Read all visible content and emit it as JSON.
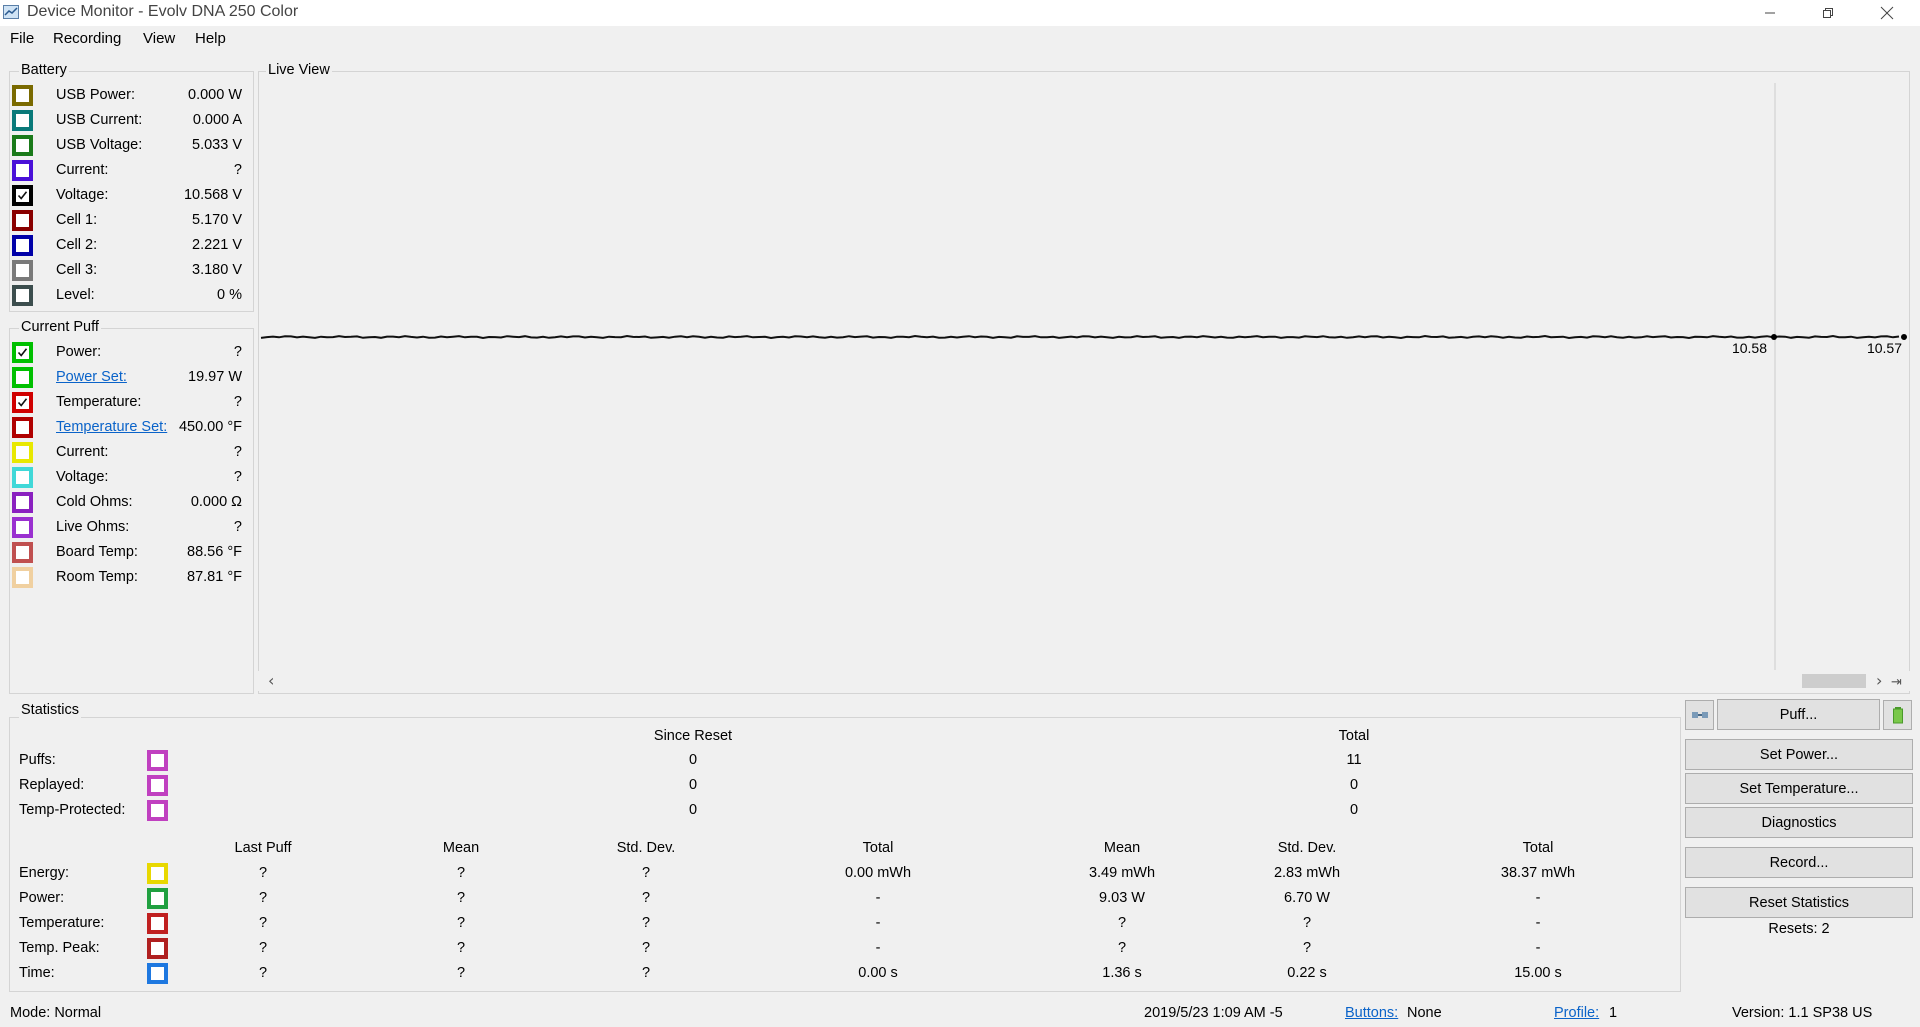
{
  "window": {
    "title": "Device Monitor - Evolv DNA 250 Color"
  },
  "menu": [
    "File",
    "Recording",
    "View",
    "Help"
  ],
  "battery": {
    "title": "Battery",
    "items": [
      {
        "label": "USB Power:",
        "value": "0.000 W",
        "color": "#7a6a00",
        "checked": false
      },
      {
        "label": "USB Current:",
        "value": "0.000 A",
        "color": "#0a7a7a",
        "checked": false
      },
      {
        "label": "USB Voltage:",
        "value": "5.033 V",
        "color": "#1a7a1a",
        "checked": false
      },
      {
        "label": "Current:",
        "value": "?",
        "color": "#4a10d8",
        "checked": false
      },
      {
        "label": "Voltage:",
        "value": "10.568 V",
        "color": "#000000",
        "checked": true
      },
      {
        "label": "Cell 1:",
        "value": "5.170 V",
        "color": "#8a0000",
        "checked": false
      },
      {
        "label": "Cell 2:",
        "value": "2.221 V",
        "color": "#0000a8",
        "checked": false
      },
      {
        "label": "Cell 3:",
        "value": "3.180 V",
        "color": "#7a7a7a",
        "checked": false
      },
      {
        "label": "Level:",
        "value": "0 %",
        "color": "#3c4e4e",
        "checked": false
      }
    ]
  },
  "current_puff": {
    "title": "Current Puff",
    "items": [
      {
        "label": "Power:",
        "value": "?",
        "color": "#00c000",
        "checked": true,
        "link": false
      },
      {
        "label": "Power Set:",
        "value": "19.97 W",
        "color": "#00c000",
        "checked": false,
        "link": true
      },
      {
        "label": "Temperature:",
        "value": "?",
        "color": "#d00000",
        "checked": true,
        "link": false
      },
      {
        "label": "Temperature Set:",
        "value": "450.00 °F",
        "color": "#b00000",
        "checked": false,
        "link": true
      },
      {
        "label": "Current:",
        "value": "?",
        "color": "#e8e800",
        "checked": false,
        "link": false
      },
      {
        "label": "Voltage:",
        "value": "?",
        "color": "#40d8d8",
        "checked": false,
        "link": false
      },
      {
        "label": "Cold Ohms:",
        "value": "0.000 Ω",
        "color": "#8a20c0",
        "checked": false,
        "link": false
      },
      {
        "label": "Live Ohms:",
        "value": "?",
        "color": "#9a30d0",
        "checked": false,
        "link": false
      },
      {
        "label": "Board Temp:",
        "value": "88.56 °F",
        "color": "#c05050",
        "checked": false,
        "link": false
      },
      {
        "label": "Room Temp:",
        "value": "87.81 °F",
        "color": "#f0d0a0",
        "checked": false,
        "link": false
      }
    ]
  },
  "live_view": {
    "title": "Live View",
    "series_value": 10.57,
    "marker_labels": [
      "10.58",
      "10.57"
    ],
    "scroll_left": "‹",
    "scroll_right": "›",
    "scroll_end": "⇥"
  },
  "statistics": {
    "title": "Statistics",
    "head1": {
      "since_reset": "Since Reset",
      "total": "Total"
    },
    "counts": [
      {
        "label": "Puffs:",
        "color": "#c040c0",
        "since_reset": "0",
        "total": "11"
      },
      {
        "label": "Replayed:",
        "color": "#c040c0",
        "since_reset": "0",
        "total": "0"
      },
      {
        "label": "Temp-Protected:",
        "color": "#c040c0",
        "since_reset": "0",
        "total": "0"
      }
    ],
    "head2": [
      "Last Puff",
      "Mean",
      "Std. Dev.",
      "Total",
      "Mean",
      "Std. Dev.",
      "Total"
    ],
    "metrics": [
      {
        "label": "Energy:",
        "color": "#e8d800",
        "values": [
          "?",
          "?",
          "?",
          "0.00 mWh",
          "3.49 mWh",
          "2.83 mWh",
          "38.37 mWh"
        ]
      },
      {
        "label": "Power:",
        "color": "#20a040",
        "values": [
          "?",
          "?",
          "?",
          "-",
          "9.03 W",
          "6.70 W",
          "-"
        ]
      },
      {
        "label": "Temperature:",
        "color": "#c02020",
        "values": [
          "?",
          "?",
          "?",
          "-",
          "?",
          "?",
          "-"
        ]
      },
      {
        "label": "Temp. Peak:",
        "color": "#b02020",
        "values": [
          "?",
          "?",
          "?",
          "-",
          "?",
          "?",
          "-"
        ]
      },
      {
        "label": "Time:",
        "color": "#1e78e0",
        "values": [
          "?",
          "?",
          "?",
          "0.00 s",
          "1.36 s",
          "0.22 s",
          "15.00 s"
        ]
      }
    ]
  },
  "actions": {
    "puff": "Puff...",
    "set_power": "Set Power...",
    "set_temperature": "Set Temperature...",
    "diagnostics": "Diagnostics",
    "record": "Record...",
    "reset_statistics": "Reset Statistics",
    "resets": "Resets: 2"
  },
  "status": {
    "mode": "Mode: Normal",
    "datetime": "2019/5/23 1:09 AM -5",
    "buttons_label": "Buttons:",
    "buttons_value": "None",
    "profile_label": "Profile:",
    "profile_value": "1",
    "version": "Version: 1.1 SP38 US"
  }
}
